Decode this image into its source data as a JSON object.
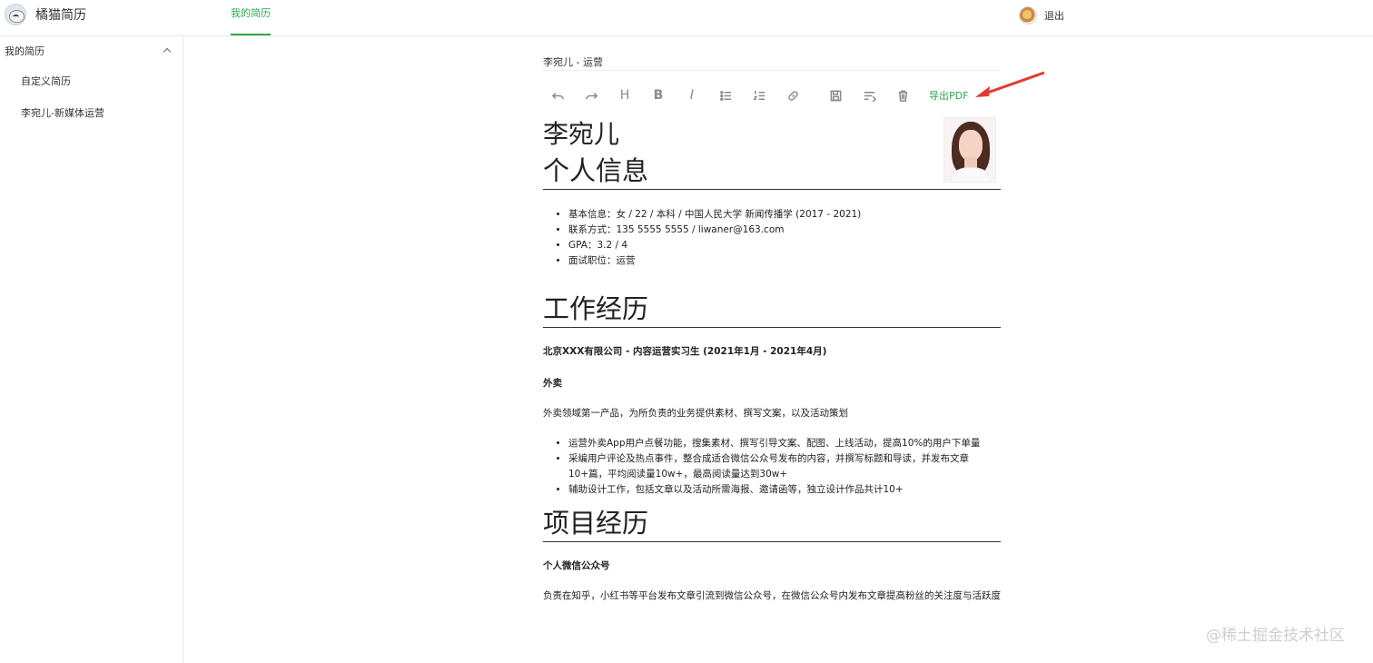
{
  "app": {
    "title": "橘猫简历"
  },
  "topnav": {
    "tab": "我的简历"
  },
  "user": {
    "logout": "退出"
  },
  "sidebar": {
    "group_label": "我的简历",
    "items": [
      {
        "label": "自定义简历"
      },
      {
        "label": "李宛儿-新媒体运营"
      }
    ]
  },
  "editor": {
    "doc_title": "李宛儿 - 运营",
    "toolbar": {
      "undo": "undo-icon",
      "redo": "redo-icon",
      "heading": "H",
      "bold": "B",
      "italic": "I",
      "export_pdf": "导出PDF"
    }
  },
  "resume": {
    "name": "李宛儿",
    "sections": {
      "personal": "个人信息",
      "work": "工作经历",
      "project": "项目经历"
    },
    "personal_info": [
      "基本信息：女 / 22 / 本科 / 中国人民大学 新闻传播学 (2017 - 2021)",
      "联系方式：135 5555 5555 / liwaner@163.com",
      "GPA：3.2 / 4",
      "面试职位：运营"
    ],
    "work": {
      "company": "北京XXX有限公司 - 内容运营实习生 (2021年1月 - 2021年4月)",
      "business": "外卖",
      "intro": "外卖领域第一产品，为所负责的业务提供素材、撰写文案，以及活动策划",
      "duties": [
        "运营外卖App用户点餐功能，搜集素材、撰写引导文案、配图、上线活动，提高10%的用户下单量",
        "采编用户评论及热点事件，整合成适合微信公众号发布的内容，并撰写标题和导读，并发布文章10+篇，平均阅读量10w+，最高阅读量达到30w+",
        "辅助设计工作，包括文章以及活动所需海报、邀请函等，独立设计作品共计10+"
      ]
    },
    "project": {
      "name": "个人微信公众号",
      "desc": "负责在知乎，小红书等平台发布文章引流到微信公众号，在微信公众号内发布文章提高粉丝的关注度与活跃度"
    }
  },
  "watermark": "@稀土掘金技术社区",
  "colors": {
    "accent": "#2fa84f",
    "arrow": "#e53935"
  }
}
